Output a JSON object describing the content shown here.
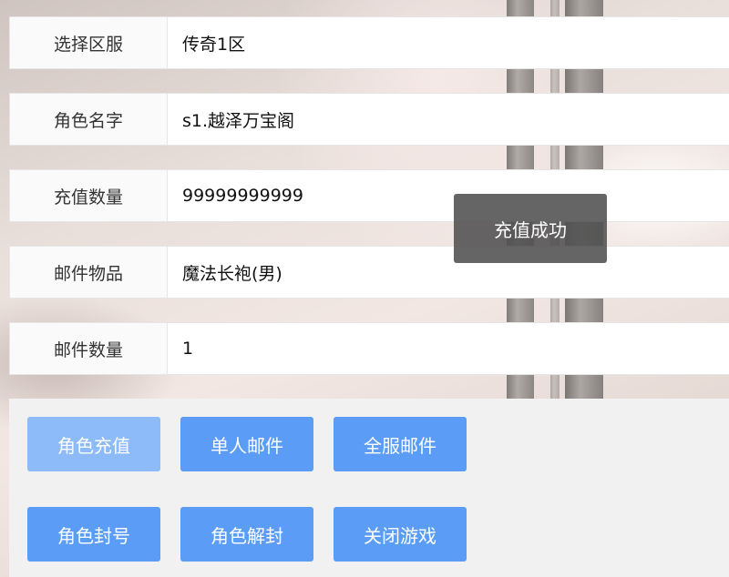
{
  "form": {
    "rows": [
      {
        "label": "选择区服",
        "value": "传奇1区"
      },
      {
        "label": "角色名字",
        "value": "s1.越泽万宝阁"
      },
      {
        "label": "充值数量",
        "value": "99999999999"
      },
      {
        "label": "邮件物品",
        "value": "魔法长袍(男)"
      },
      {
        "label": "邮件数量",
        "value": "1"
      }
    ]
  },
  "actions": {
    "row1": [
      "角色充值",
      "单人邮件",
      "全服邮件"
    ],
    "row2": [
      "角色封号",
      "角色解封",
      "关闭游戏"
    ]
  },
  "toast": {
    "message": "充值成功"
  },
  "colors": {
    "button": "#5b9cf7",
    "button_disabled": "#8dbbf9",
    "panel": "#f1f1f1",
    "toast_bg": "#505050"
  }
}
